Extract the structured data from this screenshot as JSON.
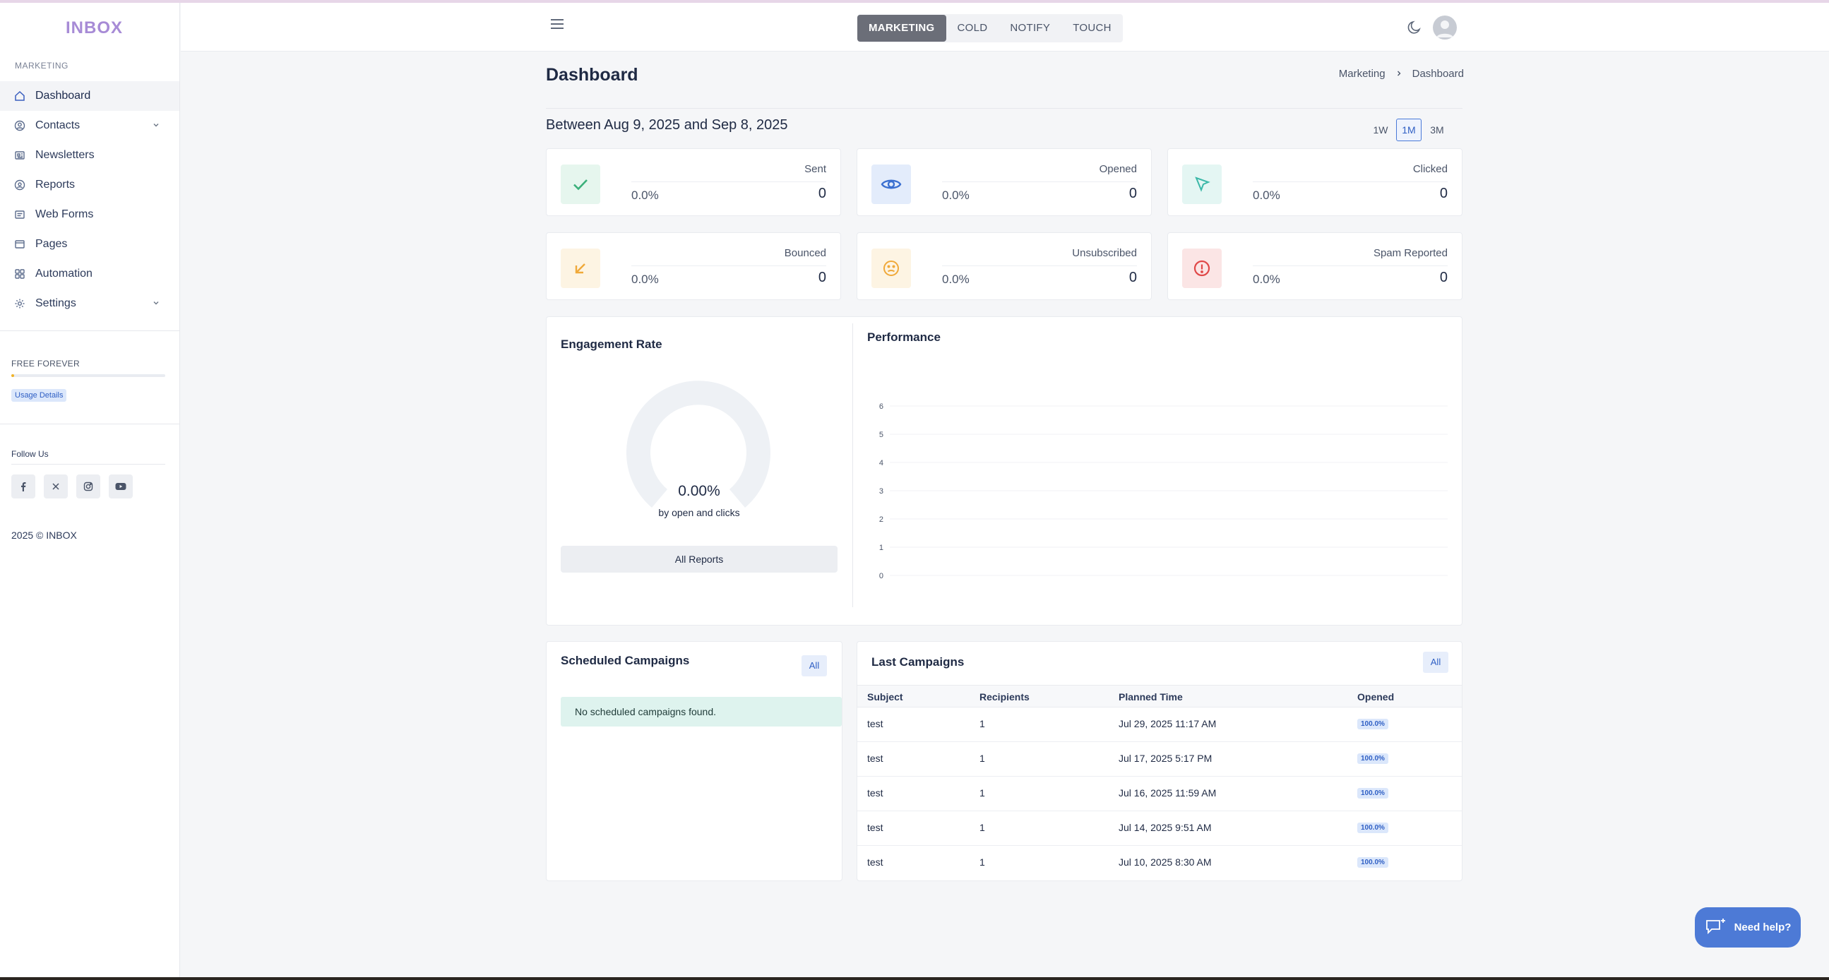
{
  "app": {
    "logo": "INBOX",
    "copyright": "2025 © INBOX"
  },
  "sidebar": {
    "section": "MARKETING",
    "items": [
      {
        "label": "Dashboard",
        "icon": "home-icon"
      },
      {
        "label": "Contacts",
        "icon": "user-circle-icon"
      },
      {
        "label": "Newsletters",
        "icon": "newspaper-icon"
      },
      {
        "label": "Reports",
        "icon": "reports-icon"
      },
      {
        "label": "Web Forms",
        "icon": "form-icon"
      },
      {
        "label": "Pages",
        "icon": "page-icon"
      },
      {
        "label": "Automation",
        "icon": "grid-icon"
      },
      {
        "label": "Settings",
        "icon": "gear-icon"
      }
    ],
    "plan": "FREE FOREVER",
    "plan_usage": 0.02,
    "usage_button": "Usage Details",
    "follow_label": "Follow Us",
    "socials": [
      "facebook-icon",
      "x-icon",
      "instagram-icon",
      "youtube-icon"
    ]
  },
  "header": {
    "tabs": [
      "MARKETING",
      "COLD",
      "NOTIFY",
      "TOUCH"
    ],
    "active_tab": "MARKETING"
  },
  "page": {
    "title": "Dashboard",
    "breadcrumb": [
      "Marketing",
      "Dashboard"
    ],
    "range": "Between Aug 9, 2025 and Sep 8, 2025",
    "periods": [
      "1W",
      "1M",
      "3M"
    ],
    "active_period": "1M"
  },
  "stats": [
    {
      "label": "Sent",
      "pct": "0.0%",
      "value": "0",
      "icon": "check-icon",
      "color": "#3bb07a",
      "bg": "#e6f6ee"
    },
    {
      "label": "Opened",
      "pct": "0.0%",
      "value": "0",
      "icon": "eye-icon",
      "color": "#3a6fd0",
      "bg": "#e3ecfb"
    },
    {
      "label": "Clicked",
      "pct": "0.0%",
      "value": "0",
      "icon": "cursor-icon",
      "color": "#3bb8a8",
      "bg": "#e4f6f3"
    },
    {
      "label": "Bounced",
      "pct": "0.0%",
      "value": "0",
      "icon": "arrow-down-left-icon",
      "color": "#f0a93a",
      "bg": "#fdf4e3"
    },
    {
      "label": "Unsubscribed",
      "pct": "0.0%",
      "value": "0",
      "icon": "frown-icon",
      "color": "#f0a93a",
      "bg": "#fdf4e3"
    },
    {
      "label": "Spam Reported",
      "pct": "0.0%",
      "value": "0",
      "icon": "alert-icon",
      "color": "#e04848",
      "bg": "#fbe5e5"
    }
  ],
  "engagement": {
    "title": "Engagement Rate",
    "value": "0.00%",
    "subtitle": "by open and clicks",
    "button": "All Reports"
  },
  "performance": {
    "title": "Performance"
  },
  "chart_data": {
    "type": "line",
    "title": "Performance",
    "series": [],
    "yticks": [
      "0",
      "1",
      "2",
      "3",
      "4",
      "5",
      "6"
    ],
    "ylim": [
      0,
      6
    ],
    "grid": true
  },
  "scheduled": {
    "title": "Scheduled Campaigns",
    "all_label": "All",
    "empty": "No scheduled campaigns found."
  },
  "last_campaigns": {
    "title": "Last Campaigns",
    "all_label": "All",
    "columns": [
      "Subject",
      "Recipients",
      "Planned Time",
      "Opened"
    ],
    "rows": [
      {
        "subject": "test",
        "recipients": "1",
        "time": "Jul 29, 2025 11:17 AM",
        "opened": "100.0%"
      },
      {
        "subject": "test",
        "recipients": "1",
        "time": "Jul 17, 2025 5:17 PM",
        "opened": "100.0%"
      },
      {
        "subject": "test",
        "recipients": "1",
        "time": "Jul 16, 2025 11:59 AM",
        "opened": "100.0%"
      },
      {
        "subject": "test",
        "recipients": "1",
        "time": "Jul 14, 2025 9:51 AM",
        "opened": "100.0%"
      },
      {
        "subject": "test",
        "recipients": "1",
        "time": "Jul 10, 2025 8:30 AM",
        "opened": "100.0%"
      }
    ]
  },
  "help": {
    "label": "Need help?"
  }
}
